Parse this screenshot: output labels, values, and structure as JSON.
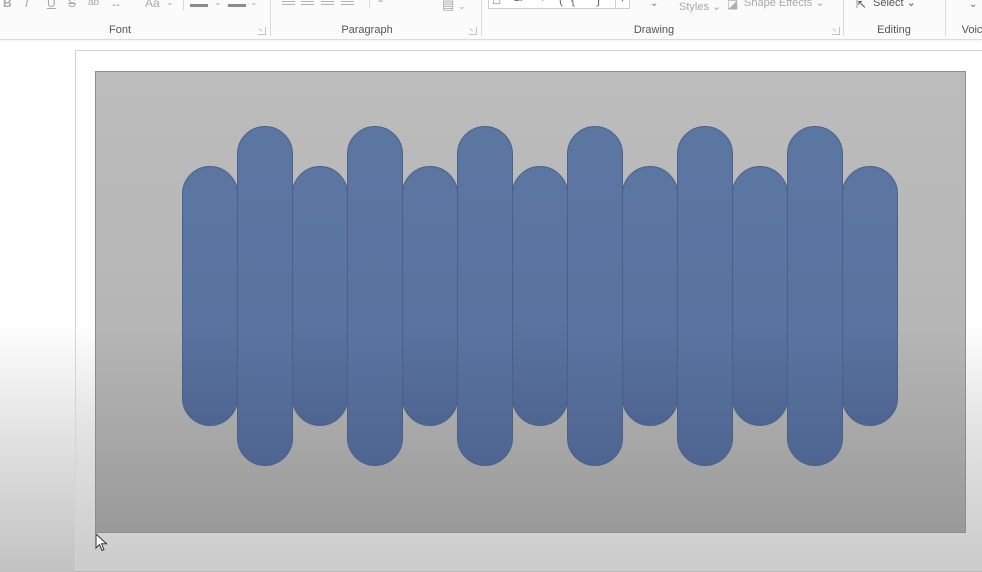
{
  "ribbon": {
    "groups": [
      {
        "label": "Font"
      },
      {
        "label": "Paragraph"
      },
      {
        "label": "Drawing"
      },
      {
        "label": "Editing"
      },
      {
        "label": "Voic"
      }
    ],
    "font_group": {
      "bold": "B",
      "italic": "I",
      "underline": "U",
      "strikethrough": "S",
      "subscript": "ab",
      "char_spacing": "↔",
      "font_size_btn": "Aa",
      "chevron": "⌄"
    },
    "drawing_group": {
      "shape_styles_label": "Styles",
      "shape_effects_label": "Shape Effects",
      "chevron": "⌄"
    },
    "editing_group": {
      "select_label": "Select",
      "chevron": "⌄"
    },
    "voice_group": {
      "chevron": "⌄"
    }
  },
  "canvas": {
    "background_color": "#b8b8b8",
    "shape_color": "#5b74a0",
    "shape_outline_color": "#4a6089",
    "shapes": [
      {
        "type": "rounded-rectangle",
        "size": "short"
      },
      {
        "type": "rounded-rectangle",
        "size": "tall"
      },
      {
        "type": "rounded-rectangle",
        "size": "short"
      },
      {
        "type": "rounded-rectangle",
        "size": "tall"
      },
      {
        "type": "rounded-rectangle",
        "size": "short"
      },
      {
        "type": "rounded-rectangle",
        "size": "tall"
      },
      {
        "type": "rounded-rectangle",
        "size": "short"
      },
      {
        "type": "rounded-rectangle",
        "size": "tall"
      },
      {
        "type": "rounded-rectangle",
        "size": "short"
      },
      {
        "type": "rounded-rectangle",
        "size": "tall"
      },
      {
        "type": "rounded-rectangle",
        "size": "short"
      },
      {
        "type": "rounded-rectangle",
        "size": "tall"
      },
      {
        "type": "rounded-rectangle",
        "size": "short"
      }
    ]
  }
}
